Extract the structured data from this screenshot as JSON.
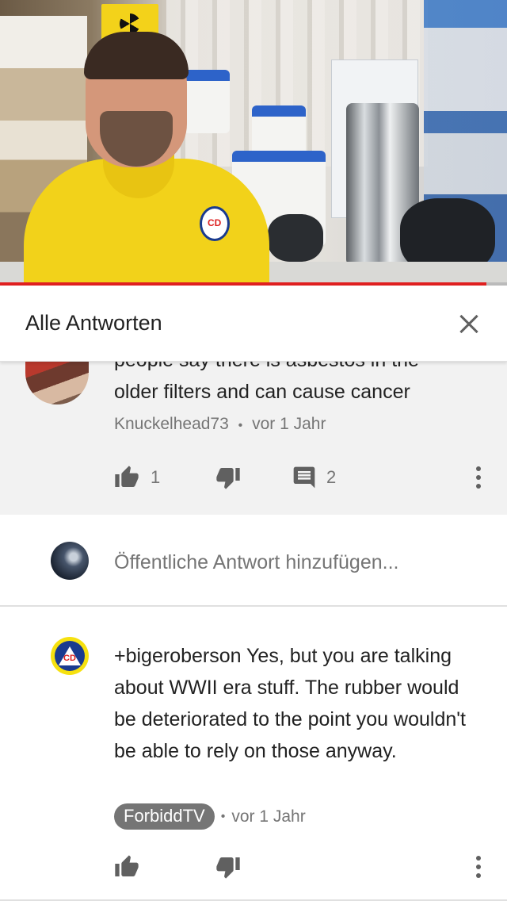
{
  "video": {
    "progress_fraction": 0.96
  },
  "header": {
    "title": "Alle Antworten"
  },
  "parent_comment": {
    "text_partial": "people say there is asbestos in the",
    "text_line2": "older filters and can cause cancer",
    "author": "Knuckelhead73",
    "separator": "•",
    "time": "vor 1 Jahr",
    "likes": "1",
    "replies": "2"
  },
  "reply_input": {
    "placeholder": "Öffentliche Antwort hinzufügen..."
  },
  "reply_comment": {
    "text": "+bigeroberson Yes, but you are talking about WWII era stuff.  The rubber would be deteriorated to the point you wouldn't be able to rely on those anyway.",
    "author": "ForbiddTV",
    "separator": "•",
    "time": "vor 1 Jahr"
  },
  "colors": {
    "accent_red": "#e02020",
    "owner_chip": "#757575",
    "parent_bg": "#f2f2f2"
  },
  "icons": [
    "close-icon",
    "thumbs-up-icon",
    "thumbs-down-icon",
    "comment-icon",
    "more-vert-icon"
  ]
}
